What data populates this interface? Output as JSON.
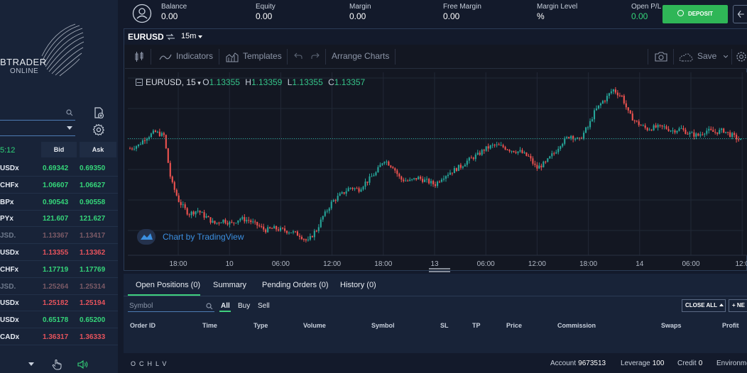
{
  "left_panel": {
    "logo_line1": "BTRADER",
    "logo_line2": "ONLINE",
    "quotes_time": "5:12",
    "bid_header": "Bid",
    "ask_header": "Ask",
    "quotes": [
      {
        "symbol": "USDx",
        "bid": "0.69342",
        "ask": "0.69350",
        "trend": "up"
      },
      {
        "symbol": "CHFx",
        "bid": "1.06607",
        "ask": "1.06627",
        "trend": "up"
      },
      {
        "symbol": "BPx",
        "bid": "0.90543",
        "ask": "0.90558",
        "trend": "up"
      },
      {
        "symbol": "PYx",
        "bid": "121.607",
        "ask": "121.627",
        "trend": "up"
      },
      {
        "symbol": "JSD.",
        "bid": "1.13367",
        "ask": "1.13417",
        "trend": "dim"
      },
      {
        "symbol": "USDx",
        "bid": "1.13355",
        "ask": "1.13362",
        "trend": "down"
      },
      {
        "symbol": "CHFx",
        "bid": "1.17719",
        "ask": "1.17769",
        "trend": "up"
      },
      {
        "symbol": "JSD.",
        "bid": "1.25264",
        "ask": "1.25314",
        "trend": "dim"
      },
      {
        "symbol": "USDx",
        "bid": "1.25182",
        "ask": "1.25194",
        "trend": "down"
      },
      {
        "symbol": "USDx",
        "bid": "0.65178",
        "ask": "0.65200",
        "trend": "up"
      },
      {
        "symbol": "CADx",
        "bid": "1.36317",
        "ask": "1.36333",
        "trend": "down"
      }
    ]
  },
  "topbar": {
    "metrics": [
      {
        "label": "Balance",
        "value": "0.00"
      },
      {
        "label": "Equity",
        "value": "0.00"
      },
      {
        "label": "Margin",
        "value": "0.00"
      },
      {
        "label": "Free Margin",
        "value": "0.00"
      },
      {
        "label": "Margin Level",
        "value": "%"
      },
      {
        "label": "Open P/L",
        "value": "0.00"
      }
    ],
    "deposit_label": "DEPOSIT"
  },
  "chart": {
    "symbol": "EURUSD",
    "timeframe": "15m",
    "toolbar": {
      "indicators": "Indicators",
      "templates": "Templates",
      "arrange": "Arrange Charts",
      "save": "Save"
    },
    "legend": {
      "symbol": "EURUSD, 15",
      "o_key": "O",
      "o": "1.13355",
      "h_key": "H",
      "h": "1.13359",
      "l_key": "L",
      "l": "1.13355",
      "c_key": "C",
      "c": "1.13357"
    },
    "attribution": "Chart by TradingView",
    "x_ticks": [
      "18:00",
      "10",
      "06:00",
      "12:00",
      "18:00",
      "13",
      "06:00",
      "12:00",
      "18:00",
      "14",
      "06:00",
      "12:0"
    ],
    "colors": {
      "up": "#26a69a",
      "down": "#ef5350",
      "background": "#131722",
      "grid": "#222836",
      "last_price_line": "#26a69a"
    }
  },
  "chart_data": {
    "type": "candlestick",
    "title": "",
    "series": [
      {
        "name": "EURUSD, 15",
        "close": [
          0.62,
          0.64,
          0.69,
          0.72,
          0.7,
          0.4,
          0.28,
          0.22,
          0.24,
          0.2,
          0.16,
          0.18,
          0.16,
          0.19,
          0.18,
          0.15,
          0.12,
          0.13,
          0.12,
          0.11,
          0.09,
          0.05,
          0.12,
          0.22,
          0.3,
          0.34,
          0.38,
          0.37,
          0.42,
          0.47,
          0.55,
          0.51,
          0.43,
          0.42,
          0.44,
          0.42,
          0.4,
          0.45,
          0.48,
          0.51,
          0.55,
          0.58,
          0.62,
          0.64,
          0.63,
          0.61,
          0.6,
          0.57,
          0.5,
          0.53,
          0.59,
          0.66,
          0.7,
          0.67,
          0.75,
          0.86,
          0.92,
          0.98,
          0.94,
          0.82,
          0.77,
          0.74,
          0.75,
          0.75,
          0.73,
          0.74,
          0.71,
          0.7,
          0.73,
          0.72,
          0.73,
          0.7,
          0.67
        ]
      }
    ],
    "x_tick_labels": [
      "18:00",
      "10",
      "06:00",
      "12:00",
      "18:00",
      "13",
      "06:00",
      "12:00",
      "18:00",
      "14",
      "06:00",
      "12:0"
    ],
    "grid": true,
    "legend": "top-left"
  },
  "bottom_panel": {
    "tabs": [
      "Open Positions (0)",
      "Summary",
      "Pending Orders (0)",
      "History (0)"
    ],
    "symbol_placeholder": "Symbol",
    "filters": [
      "All",
      "Buy",
      "Sell"
    ],
    "close_all": "CLOSE ALL",
    "new": "+ NE",
    "columns": [
      "Order ID",
      "Time",
      "Type",
      "Volume",
      "Symbol",
      "SL",
      "TP",
      "Price",
      "Commission",
      "Swaps",
      "Profit"
    ]
  },
  "status": {
    "ohlcv": "OCHLV",
    "account_label": "Account",
    "account_value": "9673513",
    "leverage_label": "Leverage",
    "leverage_value": "100",
    "credit_label": "Credit",
    "credit_value": "0",
    "environment_label": "Environme"
  }
}
